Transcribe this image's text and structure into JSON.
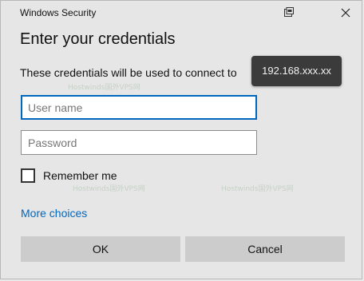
{
  "window": {
    "title": "Windows Security"
  },
  "dialog": {
    "heading": "Enter your credentials",
    "description": "These credentials will be used to connect to",
    "server_tooltip": "192.168.xxx.xx"
  },
  "form": {
    "username_placeholder": "User name",
    "password_placeholder": "Password",
    "remember_label": "Remember me",
    "more_choices_label": "More choices"
  },
  "buttons": {
    "ok_label": "OK",
    "cancel_label": "Cancel"
  },
  "watermark": {
    "text": "Hostwinds国外VPS网",
    "url": "http://www.fidker.com"
  },
  "colors": {
    "accent": "#0067c0",
    "background": "#e6e6e6",
    "button": "#cccccc",
    "tooltip": "#3b3b3b"
  }
}
